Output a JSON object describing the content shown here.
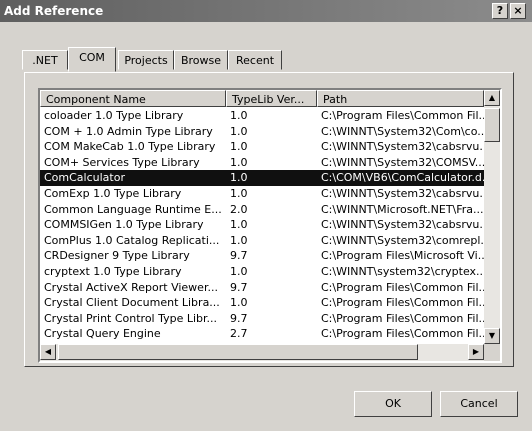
{
  "window": {
    "title": "Add Reference",
    "help_label": "?",
    "close_label": "×"
  },
  "tabs": [
    {
      "label": ".NET"
    },
    {
      "label": "COM"
    },
    {
      "label": "Projects"
    },
    {
      "label": "Browse"
    },
    {
      "label": "Recent"
    }
  ],
  "columns": [
    "Component Name",
    "TypeLib Ver...",
    "Path"
  ],
  "rows": [
    {
      "name": "coloader 1.0 Type Library",
      "ver": "1.0",
      "path": "C:\\Program Files\\Common Fil..."
    },
    {
      "name": "COM + 1.0 Admin Type Library",
      "ver": "1.0",
      "path": "C:\\WINNT\\System32\\Com\\co..."
    },
    {
      "name": "COM MakeCab 1.0 Type Library",
      "ver": "1.0",
      "path": "C:\\WINNT\\System32\\cabsrvu..."
    },
    {
      "name": "COM+ Services Type Library",
      "ver": "1.0",
      "path": "C:\\WINNT\\System32\\COMSV..."
    },
    {
      "name": "ComCalculator",
      "ver": "1.0",
      "path": "C:\\COM\\VB6\\ComCalculator.d..."
    },
    {
      "name": "ComExp 1.0 Type Library",
      "ver": "1.0",
      "path": "C:\\WINNT\\System32\\cabsrvu..."
    },
    {
      "name": "Common Language Runtime E...",
      "ver": "2.0",
      "path": "C:\\WINNT\\Microsoft.NET\\Fra..."
    },
    {
      "name": "COMMSIGen 1.0 Type Library",
      "ver": "1.0",
      "path": "C:\\WINNT\\System32\\cabsrvu..."
    },
    {
      "name": "ComPlus 1.0 Catalog Replicati...",
      "ver": "1.0",
      "path": "C:\\WINNT\\System32\\comrepl..."
    },
    {
      "name": "CRDesigner 9 Type Library",
      "ver": "9.7",
      "path": "C:\\Program Files\\Microsoft Vi..."
    },
    {
      "name": "cryptext 1.0 Type Library",
      "ver": "1.0",
      "path": "C:\\WINNT\\system32\\cryptex..."
    },
    {
      "name": "Crystal ActiveX Report Viewer...",
      "ver": "9.7",
      "path": "C:\\Program Files\\Common Fil..."
    },
    {
      "name": "Crystal Client Document Libra...",
      "ver": "1.0",
      "path": "C:\\Program Files\\Common Fil..."
    },
    {
      "name": "Crystal Print Control Type Libr...",
      "ver": "9.7",
      "path": "C:\\Program Files\\Common Fil..."
    },
    {
      "name": "Crystal Query Engine",
      "ver": "2.7",
      "path": "C:\\Program Files\\Common Fil..."
    }
  ],
  "selected_row": 4,
  "buttons": {
    "ok": "OK",
    "cancel": "Cancel"
  }
}
